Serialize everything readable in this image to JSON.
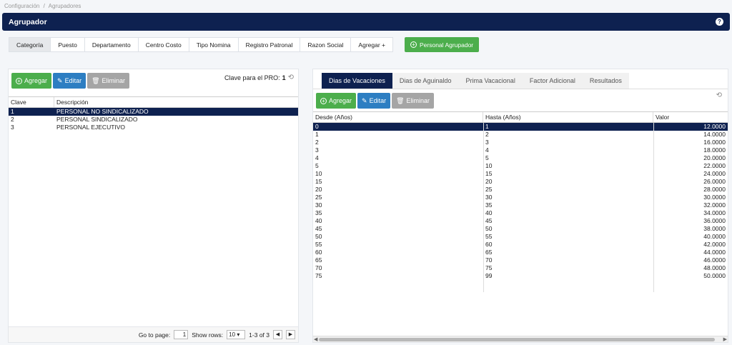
{
  "breadcrumb": [
    "Configuración",
    "/",
    "Agrupadores"
  ],
  "header": {
    "title": "Agrupador",
    "help": "?"
  },
  "tabs": [
    "Categoría",
    "Puesto",
    "Departamento",
    "Centro Costo",
    "Tipo Nomina",
    "Registro Patronal",
    "Razon Social",
    "Agregar +"
  ],
  "personal_button": "Personal Agrupador",
  "left": {
    "add": "Agregar",
    "edit": "Editar",
    "delete": "Eliminar",
    "pro_label": "Clave para el PRO:",
    "pro_value": "1",
    "columns": [
      "Clave",
      "Descripción"
    ],
    "rows": [
      [
        "1",
        "PERSONAL NO SINDICALIZADO"
      ],
      [
        "2",
        "PERSONAL SINDICALIZADO"
      ],
      [
        "3",
        "PERSONAL EJECUTIVO"
      ]
    ],
    "pager": {
      "goto": "Go to page:",
      "page": "1",
      "show": "Show rows:",
      "rows": "10",
      "range": "1-3 of 3"
    }
  },
  "right": {
    "tabs": [
      "Dias de Vacaciones",
      "Dias de Aguinaldo",
      "Prima Vacacional",
      "Factor Adicional",
      "Resultados"
    ],
    "add": "Agregar",
    "edit": "Editar",
    "delete": "Eliminar",
    "columns": [
      "Desde (Años)",
      "Hasta (Años)",
      "Valor"
    ],
    "rows": [
      [
        "0",
        "1",
        "12.0000"
      ],
      [
        "1",
        "2",
        "14.0000"
      ],
      [
        "2",
        "3",
        "16.0000"
      ],
      [
        "3",
        "4",
        "18.0000"
      ],
      [
        "4",
        "5",
        "20.0000"
      ],
      [
        "5",
        "10",
        "22.0000"
      ],
      [
        "10",
        "15",
        "24.0000"
      ],
      [
        "15",
        "20",
        "26.0000"
      ],
      [
        "20",
        "25",
        "28.0000"
      ],
      [
        "25",
        "30",
        "30.0000"
      ],
      [
        "30",
        "35",
        "32.0000"
      ],
      [
        "35",
        "40",
        "34.0000"
      ],
      [
        "40",
        "45",
        "36.0000"
      ],
      [
        "45",
        "50",
        "38.0000"
      ],
      [
        "50",
        "55",
        "40.0000"
      ],
      [
        "55",
        "60",
        "42.0000"
      ],
      [
        "60",
        "65",
        "44.0000"
      ],
      [
        "65",
        "70",
        "46.0000"
      ],
      [
        "70",
        "75",
        "48.0000"
      ],
      [
        "75",
        "99",
        "50.0000"
      ]
    ]
  },
  "colors": {
    "navy": "#0e2150",
    "green": "#4cae4c",
    "blue": "#2d7ec2",
    "gray": "#a5a5a5"
  }
}
